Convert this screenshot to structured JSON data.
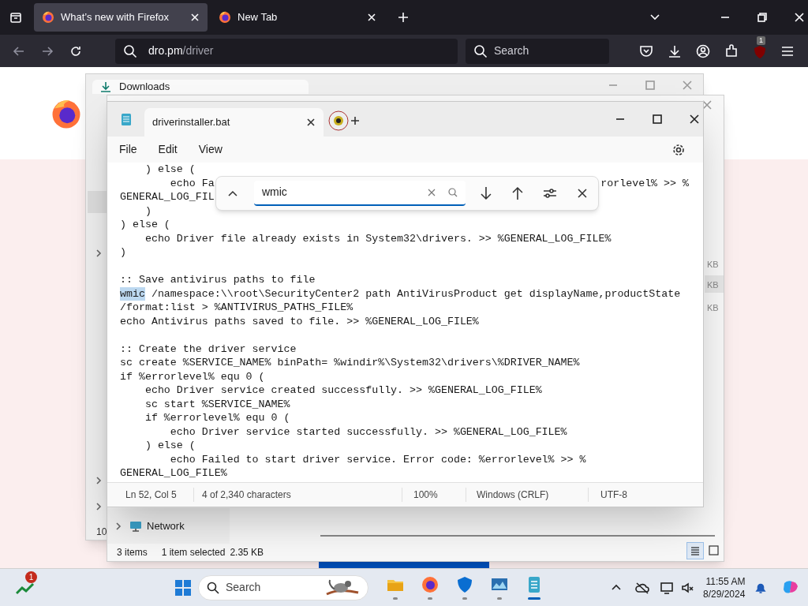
{
  "browser": {
    "tabs": [
      {
        "label": "What’s new with Firefox",
        "selected": true
      },
      {
        "label": "New Tab",
        "selected": false
      }
    ],
    "address": {
      "host": "dro.pm",
      "path": "/driver"
    },
    "search": {
      "placeholder": "Search"
    },
    "extension_badge": "1"
  },
  "downloads_window": {
    "tab": "Downloads",
    "nav_fragment": "10"
  },
  "explorer_window": {
    "sizes": [
      "KB",
      "KB",
      "KB"
    ],
    "nav_item": "Network",
    "status": {
      "items": "3 items",
      "selection": "1 item selected",
      "size": "2.35 KB"
    }
  },
  "notepad": {
    "tab": "driverinstaller.bat",
    "menu": [
      "File",
      "Edit",
      "View"
    ],
    "find": {
      "value": "wmic"
    },
    "blocks": [
      [
        "    ) else (",
        {
          "parts": [
            {
              "kind": "plain",
              "text": "        echo Fa"
            },
            {
              "kind": "tail",
              "text": "rorlevel% >> %"
            }
          ]
        },
        "GENERAL_LOG_FIL",
        "    )",
        ") else (",
        "    echo Driver file already exists in System32\\drivers. >> %GENERAL_LOG_FILE%",
        ")"
      ],
      [
        ":: Save antivirus paths to file",
        {
          "parts": [
            {
              "kind": "match",
              "text": "wmic"
            },
            {
              "kind": "plain",
              "text": " /namespace:\\\\root\\SecurityCenter2 path AntiVirusProduct get displayName,productState"
            }
          ]
        },
        "/format:list > %ANTIVIRUS_PATHS_FILE%",
        "echo Antivirus paths saved to file. >> %GENERAL_LOG_FILE%"
      ],
      [
        ":: Create the driver service",
        "sc create %SERVICE_NAME% binPath= %windir%\\System32\\drivers\\%DRIVER_NAME%",
        "if %errorlevel% equ 0 (",
        "    echo Driver service created successfully. >> %GENERAL_LOG_FILE%",
        "    sc start %SERVICE_NAME%",
        "    if %errorlevel% equ 0 (",
        "        echo Driver service started successfully. >> %GENERAL_LOG_FILE%",
        "    ) else (",
        "        echo Failed to start driver service. Error code: %errorlevel% >> %",
        "GENERAL_LOG_FILE%"
      ]
    ],
    "status": [
      "Ln 52, Col 5",
      "4 of 2,340 characters",
      "100%",
      "Windows (CRLF)",
      "UTF-8"
    ]
  },
  "taskbar": {
    "widget_badge": "1",
    "search": {
      "placeholder": "Search"
    },
    "apps": [
      {
        "kind": "folder",
        "active": false
      },
      {
        "kind": "firefox",
        "active": false
      },
      {
        "kind": "shield",
        "active": false
      },
      {
        "kind": "monitor",
        "active": false
      },
      {
        "kind": "notepad",
        "active": true
      }
    ],
    "time": "11:55 AM",
    "date": "8/29/2024"
  }
}
